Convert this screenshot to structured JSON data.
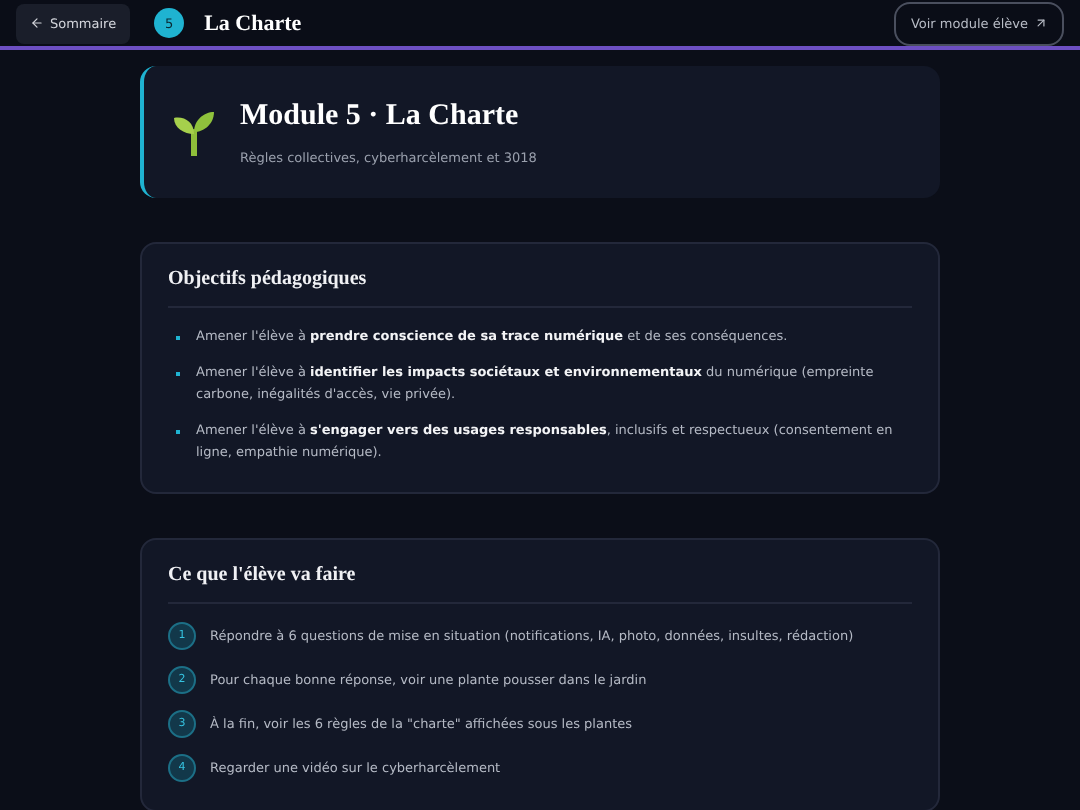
{
  "header": {
    "back_button": "Sommaire",
    "module_number": "5",
    "title": "La Charte",
    "student_button": "Voir module élève"
  },
  "hero": {
    "title": "Module 5 · La Charte",
    "subtitle": "Règles collectives, cyberharcèlement et 3018"
  },
  "objectives": {
    "title": "Objectifs pédagogiques",
    "items": [
      "Amener l'élève à **prendre conscience de sa trace numérique** et de ses conséquences.",
      "Amener l'élève à **identifier les impacts sociétaux et environnementaux** du numérique (empreinte carbone, inégalités d'accès, vie privée).",
      "Amener l'élève à **s'engager vers des usages responsables**, inclusifs et respectueux (consentement en ligne, empathie numérique)."
    ]
  },
  "activities": {
    "title": "Ce que l'élève va faire",
    "steps": [
      {
        "number": "1",
        "text": "Répondre à 6 questions de mise en situation (notifications, IA, photo, données, insultes, rédaction)"
      },
      {
        "number": "2",
        "text": "Pour chaque bonne réponse, voir une plante pousser dans le jardin"
      },
      {
        "number": "3",
        "text": "À la fin, voir les 6 règles de la \"charte\" affichées sous les plantes"
      },
      {
        "number": "4",
        "text": "Regarder une vidéo sur le cyberharcèlement"
      }
    ]
  }
}
